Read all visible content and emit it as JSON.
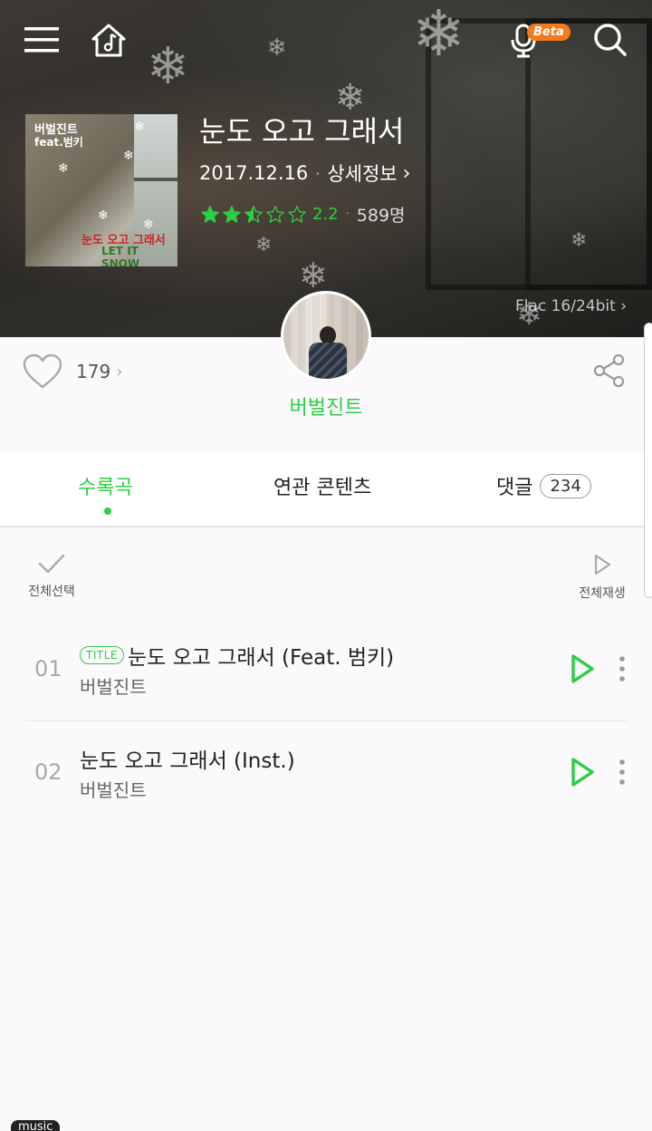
{
  "header": {
    "beta_label": "Beta"
  },
  "album": {
    "title": "눈도 오고 그래서",
    "date": "2017.12.16",
    "detail_link": "상세정보",
    "rating": 2.2,
    "rating_text": "2.2",
    "rating_count": "589명",
    "quality": "Flac 16/24bit",
    "cover_text": {
      "line1": "버벌진트",
      "line2": "feat.범키",
      "line3": "눈도 오고 그래서",
      "line4": "LET IT SNOW"
    }
  },
  "social": {
    "likes": "179"
  },
  "artist": {
    "name": "버벌진트"
  },
  "tabs": [
    {
      "label": "수록곡",
      "active": true
    },
    {
      "label": "연관 콘텐츠",
      "active": false
    },
    {
      "label": "댓글",
      "badge": "234",
      "active": false
    }
  ],
  "list_controls": {
    "select_all": "전체선택",
    "play_all": "전체재생"
  },
  "tracks": [
    {
      "num": "01",
      "badge": "TITLE",
      "title": "눈도 오고 그래서 (Feat. 범키)",
      "artist": "버벌진트"
    },
    {
      "num": "02",
      "badge": "",
      "title": "눈도 오고 그래서 (Inst.)",
      "artist": "버벌진트"
    }
  ],
  "bottom_tag": "music",
  "colors": {
    "accent": "#2ccf41",
    "beta": "#f47b1c"
  }
}
